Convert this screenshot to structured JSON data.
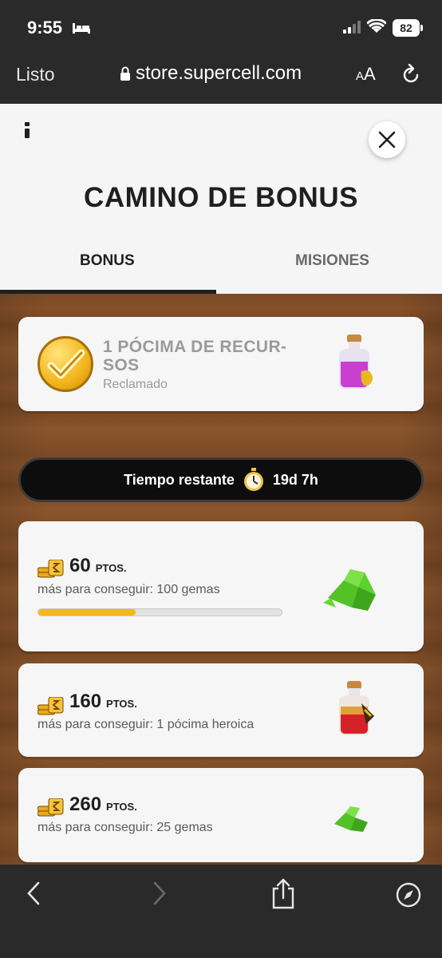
{
  "status_bar": {
    "time": "9:55",
    "battery": "82"
  },
  "browser": {
    "done_label": "Listo",
    "url": "store.supercell.com",
    "text_size_label_big": "A",
    "text_size_label_small": "A"
  },
  "header": {
    "title": "CAMINO DE BONUS",
    "tabs": [
      {
        "label": "BONUS",
        "active": true
      },
      {
        "label": "MISIONES",
        "active": false
      }
    ]
  },
  "claimed_reward": {
    "title": "1 PÓCIMA DE RECUR-SOS",
    "title_line1": "1 PÓCIMA DE RECUR-",
    "title_line2": "SOS",
    "status": "Reclamado",
    "icon": "resource-potion-icon"
  },
  "timer": {
    "label": "Tiempo restante",
    "value": "19d 7h"
  },
  "milestones": [
    {
      "points": "60",
      "unit": "PTOS.",
      "description": "más para conseguir: 100 gemas",
      "progress": 0.4,
      "icon": "gems-pile-icon"
    },
    {
      "points": "160",
      "unit": "PTOS.",
      "description": "más para conseguir: 1 pócima heroica",
      "icon": "hero-potion-icon"
    },
    {
      "points": "260",
      "unit": "PTOS.",
      "description": "más para conseguir: 25 gemas",
      "icon": "gems-small-icon"
    }
  ],
  "colors": {
    "progress_fill": "#f5b81c",
    "wood": "#7a4a25",
    "timer_bg": "#0d0d0d"
  }
}
